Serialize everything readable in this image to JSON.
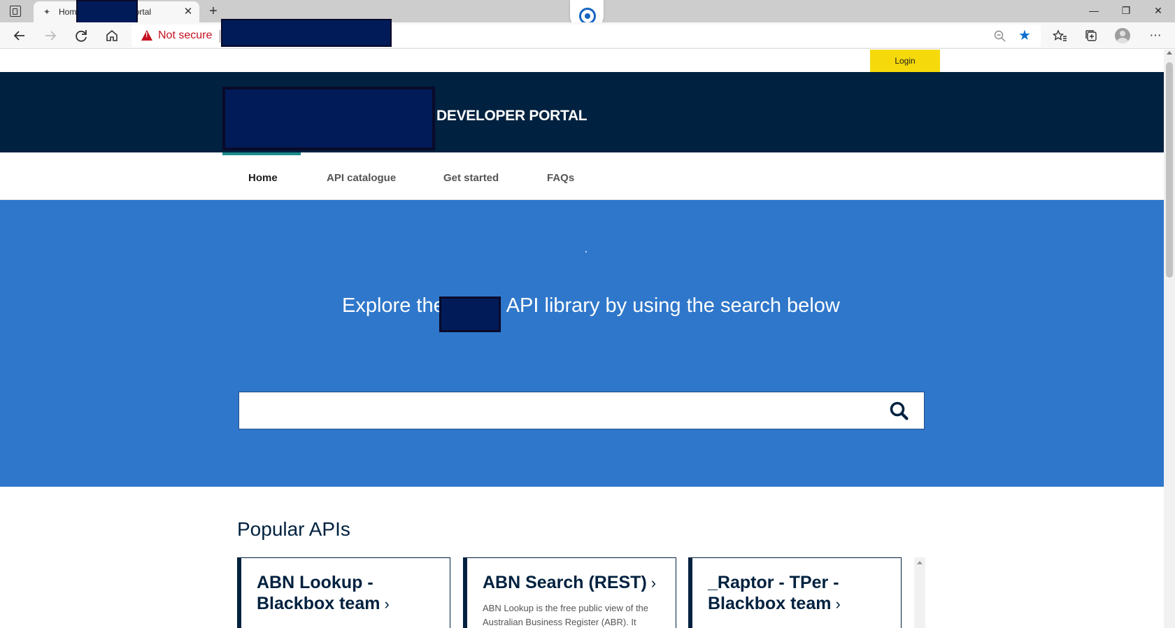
{
  "browser": {
    "tab_title": "Home - Developer Portal",
    "tab_close": "✕",
    "new_tab": "+",
    "not_secure_label": "Not secure",
    "window": {
      "minimize": "—",
      "restore": "❐",
      "close": "✕"
    }
  },
  "icons": {
    "back": "back-arrow-icon",
    "forward": "forward-arrow-icon",
    "refresh": "refresh-icon",
    "home": "home-icon",
    "warning": "warning-icon",
    "zoom": "zoom-out-icon",
    "favorite": "star-icon",
    "search": "search-icon"
  },
  "utility": {
    "login_label": "Login"
  },
  "banner": {
    "portal_title": "DEVELOPER PORTAL"
  },
  "nav": {
    "items": [
      {
        "label": "Home",
        "active": true
      },
      {
        "label": "API catalogue",
        "active": false
      },
      {
        "label": "Get started",
        "active": false
      },
      {
        "label": "FAQs",
        "active": false
      }
    ]
  },
  "search": {
    "heading_before": "Explore the",
    "heading_after": "API library by using the search below",
    "placeholder": ""
  },
  "popular": {
    "heading": "Popular APIs",
    "cards": [
      {
        "title": "ABN Lookup - Blackbox team",
        "description": ""
      },
      {
        "title": "ABN Search (REST)",
        "description": "ABN Lookup is the free public view of the Australian Business Register (ABR). It"
      },
      {
        "title": "_Raptor - TPer - Blackbox team",
        "description": ""
      }
    ]
  },
  "colors": {
    "banner_bg": "#00213f",
    "search_bg": "#2f77ca",
    "login_bg": "#f5d90a",
    "nav_active": "#1c8c8c",
    "warning_red": "#c50f1f",
    "favorite_blue": "#0b6fd0"
  }
}
